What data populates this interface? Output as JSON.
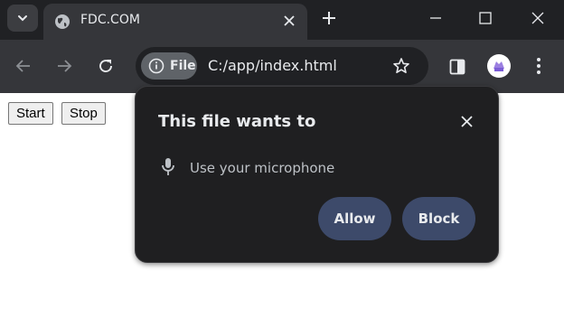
{
  "tab": {
    "title": "FDC.COM",
    "icon": "globe-icon"
  },
  "omnibox": {
    "chip_label": "File",
    "url": "C:/app/index.html"
  },
  "colors": {
    "titlebar": "#202124",
    "toolbar": "#35363a",
    "omnibox": "#202124",
    "popup_bg": "#1f1f21",
    "popup_button": "#3d4a6a",
    "text": "#e8eaed"
  },
  "page": {
    "buttons": [
      "Start",
      "Stop"
    ]
  },
  "permission_prompt": {
    "title": "This file wants to",
    "permission": "Use your microphone",
    "allow_label": "Allow",
    "block_label": "Block"
  }
}
